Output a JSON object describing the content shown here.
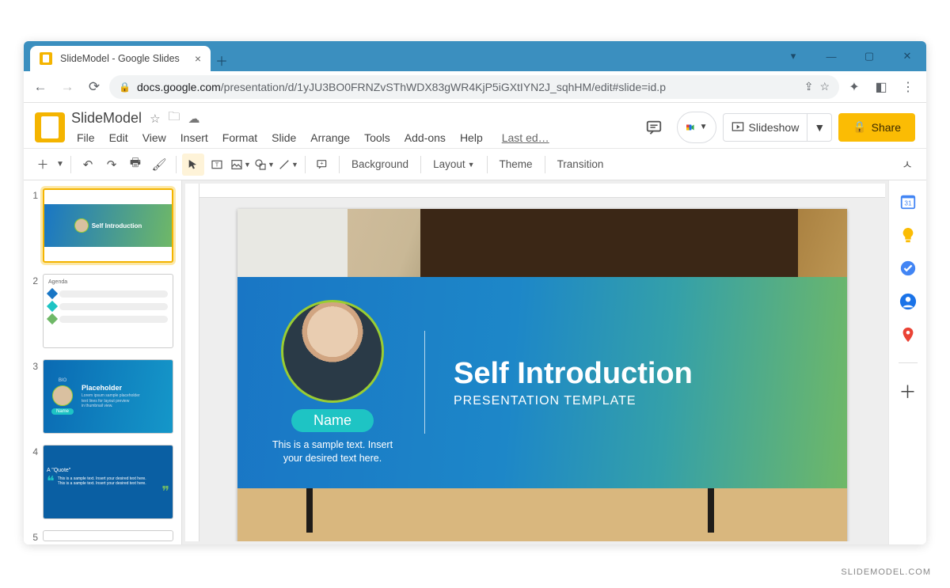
{
  "browser": {
    "tab_title": "SlideModel - Google Slides",
    "url_host": "docs.google.com",
    "url_path": "/presentation/d/1yJU3BO0FRNZvSThWDX83gWR4KjP5iGXtIYN2J_sqhHM/edit#slide=id.p"
  },
  "app": {
    "title": "SlideModel",
    "menu": [
      "File",
      "Edit",
      "View",
      "Insert",
      "Format",
      "Slide",
      "Arrange",
      "Tools",
      "Add-ons",
      "Help"
    ],
    "last_edit": "Last ed…",
    "slideshow_label": "Slideshow",
    "share_label": "Share"
  },
  "toolbar": {
    "background": "Background",
    "layout": "Layout",
    "theme": "Theme",
    "transition": "Transition"
  },
  "thumbnails": [
    {
      "num": "1",
      "label": "Self Introduction",
      "active": true
    },
    {
      "num": "2",
      "label": "Agenda"
    },
    {
      "num": "3",
      "label": "Placeholder",
      "title": "BIO"
    },
    {
      "num": "4",
      "label": "A \"Quote\""
    },
    {
      "num": "5",
      "label": ""
    }
  ],
  "slide": {
    "title": "Self Introduction",
    "subtitle": "PRESENTATION TEMPLATE",
    "name_label": "Name",
    "sample_text": "This is a sample text. Insert your desired text here."
  },
  "watermark": "SLIDEMODEL.COM"
}
